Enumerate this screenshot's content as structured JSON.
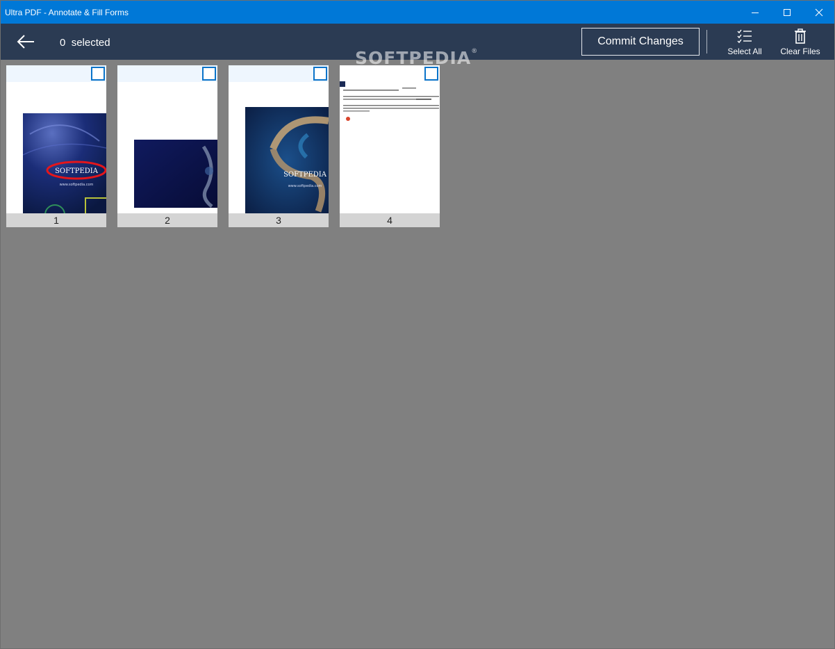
{
  "window": {
    "title": "Ultra PDF - Annotate & Fill Forms",
    "accent_color": "#0078d7"
  },
  "appbar": {
    "background_color": "#2b3b53",
    "back_icon": "arrow-left-icon",
    "selected_count": "0",
    "selected_label": "selected",
    "commit_label": "Commit Changes",
    "select_all_label": "Select All",
    "select_all_icon": "checklist-icon",
    "clear_files_label": "Clear Files",
    "clear_files_icon": "trash-icon"
  },
  "watermark": {
    "text": "SOFTPEDIA",
    "mark": "®"
  },
  "pages": [
    {
      "number": "1",
      "checked": false,
      "thumb_text": "SOFTPEDIA",
      "thumb_subtext": "www.softpedia.com"
    },
    {
      "number": "2",
      "checked": false
    },
    {
      "number": "3",
      "checked": false,
      "thumb_text": "SOFTPEDIA",
      "thumb_subtext": "www.softpedia.com"
    },
    {
      "number": "4",
      "checked": false
    }
  ]
}
